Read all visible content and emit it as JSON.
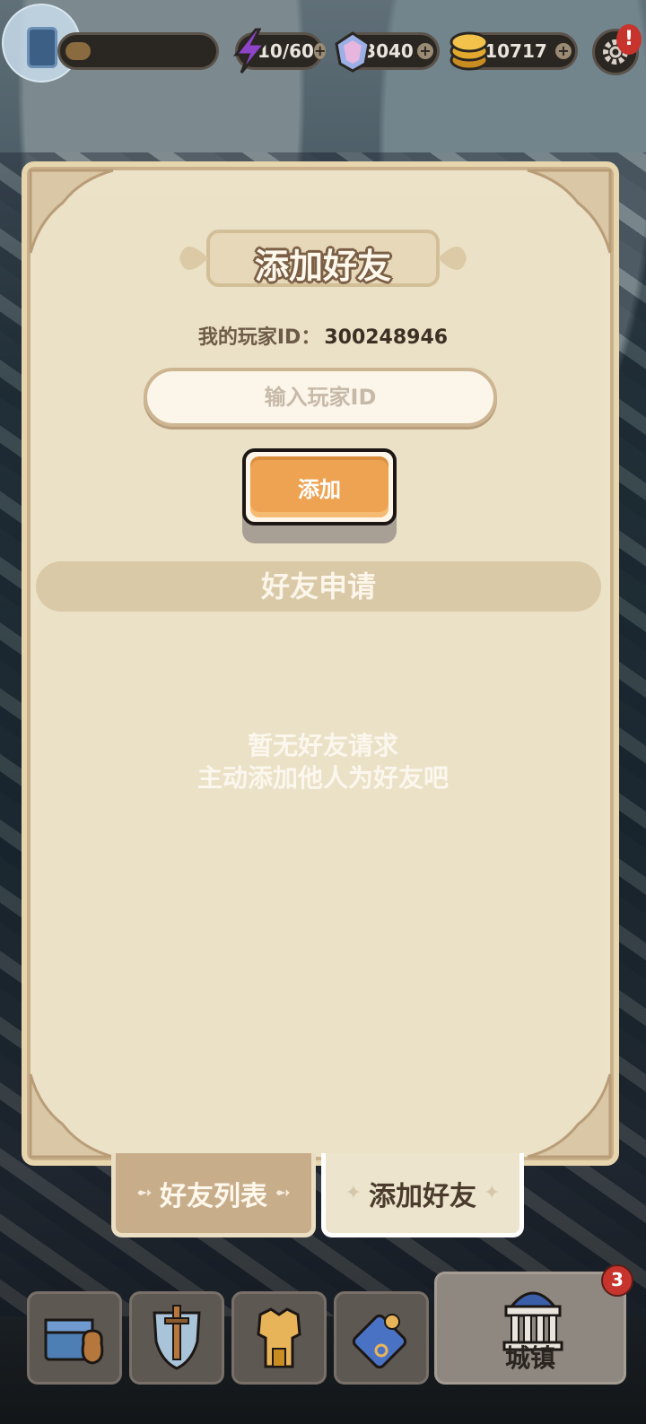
{
  "hud": {
    "energy": "10/60",
    "gems": "3040",
    "coins": "10717",
    "settings_badge": "!"
  },
  "panel": {
    "title": "添加好友",
    "my_id_label": "我的玩家ID：",
    "my_id_value": "300248946",
    "input_placeholder": "输入玩家ID",
    "add_button": "添加",
    "requests_header": "好友申请",
    "empty_line1": "暂无好友请求",
    "empty_line2": "主动添加他人为好友吧"
  },
  "tabs": [
    {
      "label": "好友列表",
      "active": false
    },
    {
      "label": "添加好友",
      "active": true
    }
  ],
  "bottom_nav": {
    "items": [
      "chest-icon",
      "sword-shield-icon",
      "armor-icon",
      "map-icon"
    ],
    "town_label": "城镇",
    "town_badge": "3"
  },
  "colors": {
    "panel_bg": "#ebe1c6",
    "button_orange": "#eea352",
    "badge_red": "#c7342d"
  }
}
